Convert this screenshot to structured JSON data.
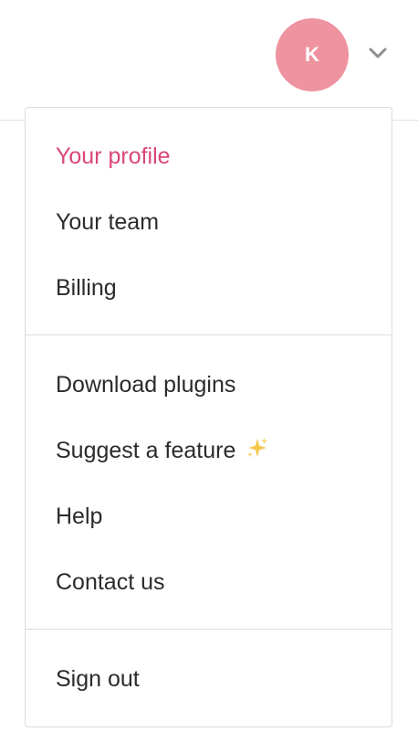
{
  "header": {
    "avatar_initial": "K",
    "avatar_color": "#ee939f",
    "dropdown_icon": "chevron-down-icon"
  },
  "menu": {
    "active_color": "#d9467a",
    "sections": [
      {
        "items": [
          {
            "label": "Your profile",
            "active": true
          },
          {
            "label": "Your team"
          },
          {
            "label": "Billing"
          }
        ]
      },
      {
        "items": [
          {
            "label": "Download plugins"
          },
          {
            "label": "Suggest a feature",
            "icon": "sparkles-icon"
          },
          {
            "label": "Help"
          },
          {
            "label": "Contact us"
          }
        ]
      },
      {
        "items": [
          {
            "label": "Sign out"
          }
        ]
      }
    ]
  }
}
